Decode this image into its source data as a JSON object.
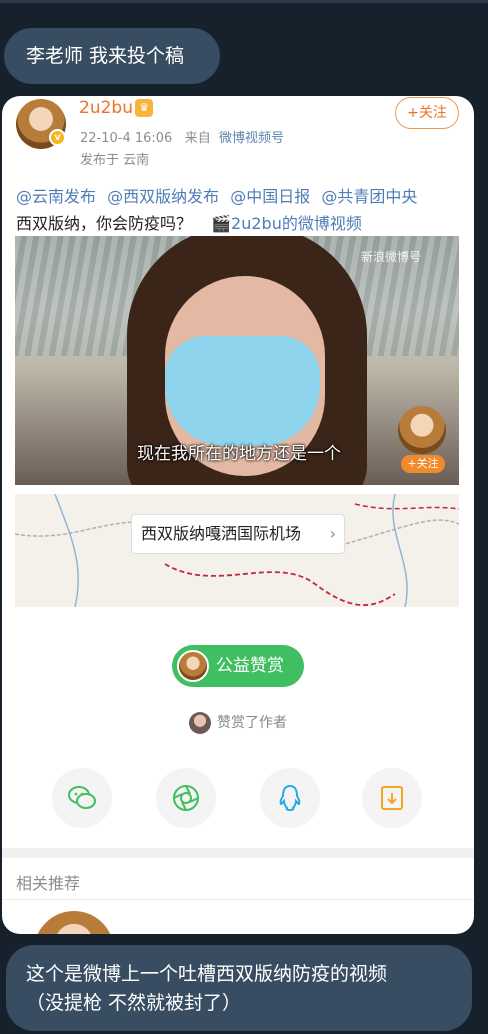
{
  "messages": {
    "top": "李老师 我来投个稿",
    "bottom_line1": "这个是微博上一个吐槽西双版纳防疫的视频",
    "bottom_line2": "（没提枪 不然就被封了）"
  },
  "post": {
    "username": "2u2bu",
    "date": "22-10-4 16:06",
    "from_label": "来自",
    "source": "微博视频号",
    "location": "发布于 云南",
    "follow_label": "+关注",
    "mentions": [
      "@云南发布",
      "@西双版纳发布",
      "@中国日报",
      "@共青团中央"
    ],
    "body": "西双版纳，你会防疫吗？",
    "video_link": "🎬2u2bu的微博视频",
    "video_subtitle": "现在我所在的地方还是一个",
    "video_watermark": "新浪微博号",
    "video_follow": "+关注",
    "map_label": "西双版纳嘎洒国际机场",
    "reward_label": "公益赞赏",
    "tipper_text": "赞赏了作者",
    "related_title": "相关推荐"
  },
  "icons": [
    "wechat-icon",
    "moments-icon",
    "qq-icon",
    "save-image-icon"
  ],
  "colors": {
    "background": "#17212b",
    "bubble": "#384d61",
    "username": "#eb7326",
    "link": "#4f7db8",
    "reward": "#3fbf61"
  }
}
